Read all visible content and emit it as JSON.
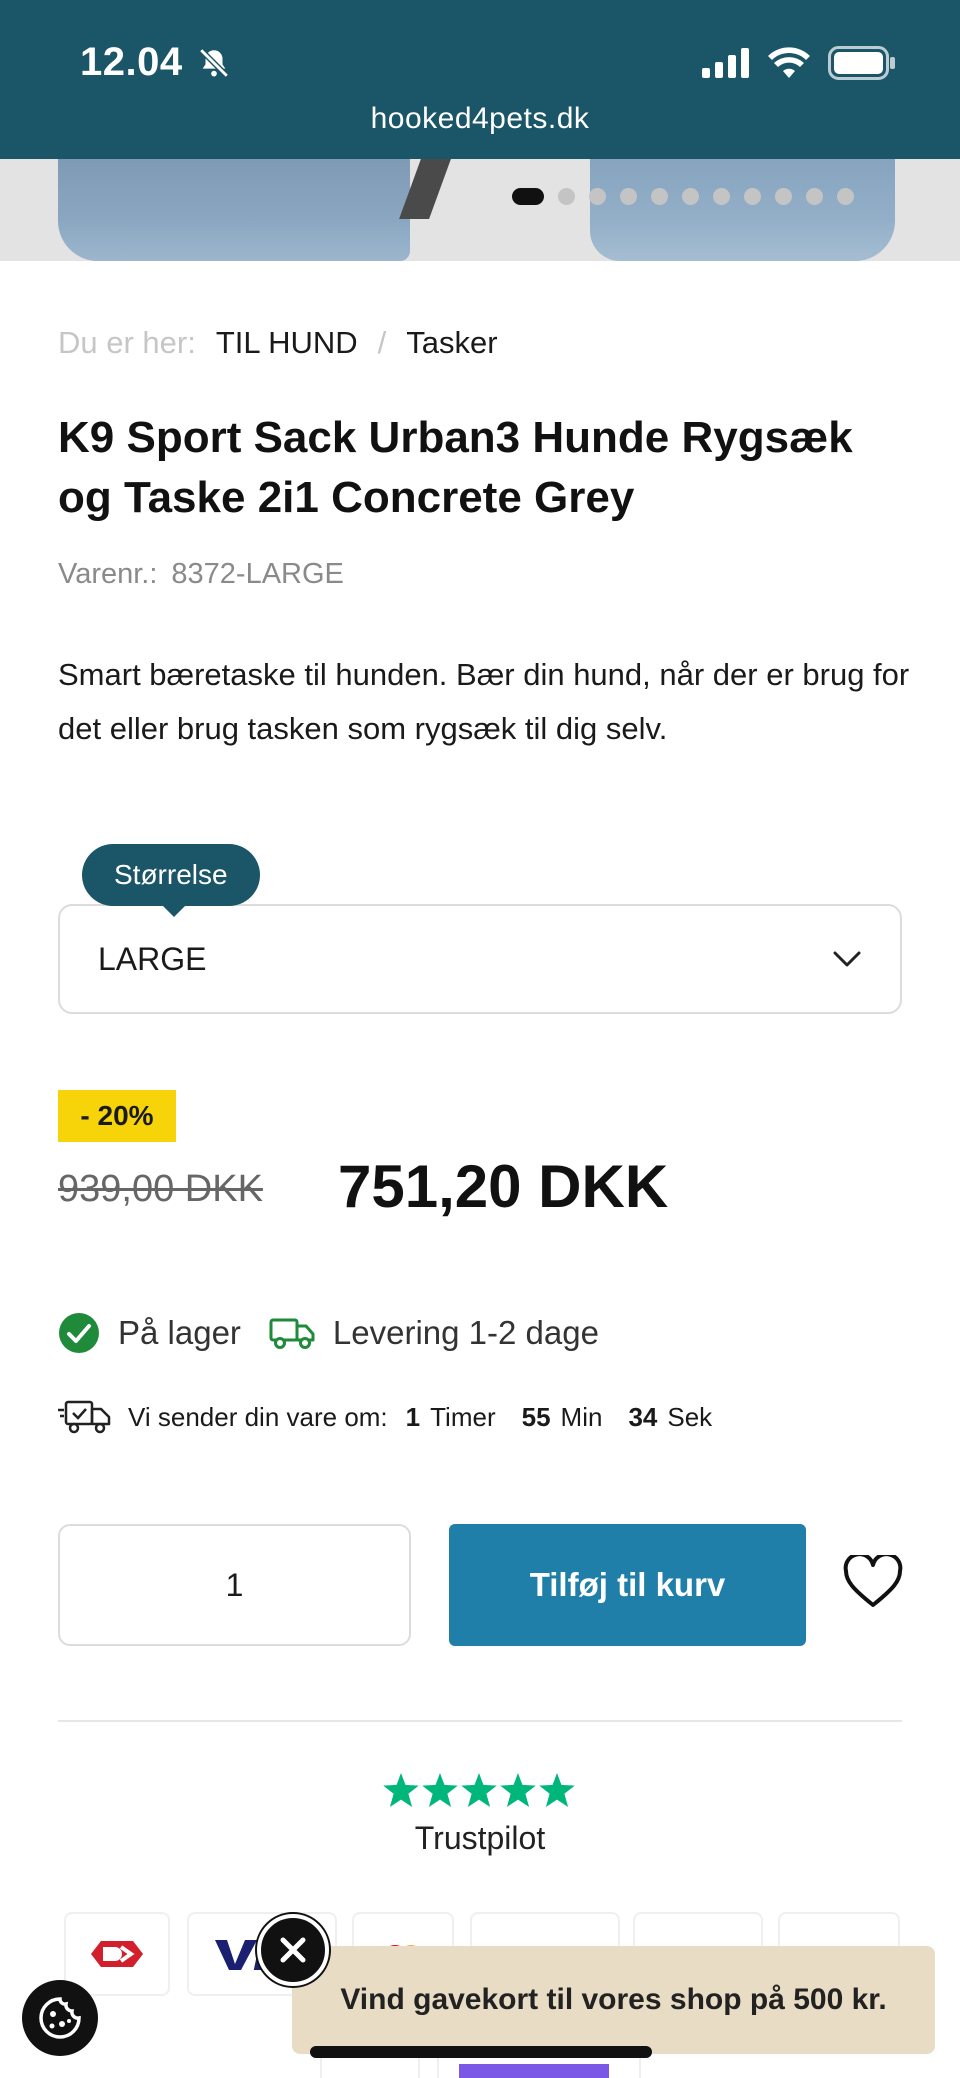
{
  "status_bar": {
    "time": "12.04"
  },
  "browser": {
    "url": "hooked4pets.dk"
  },
  "breadcrumb": {
    "prefix": "Du er her:",
    "items": [
      "TIL HUND",
      "Tasker"
    ],
    "separator": "/"
  },
  "product": {
    "title": "K9 Sport Sack Urban3 Hunde Rygsæk og Taske 2i1 Concrete Grey",
    "sku_label": "Varenr.:",
    "sku": "8372-LARGE",
    "description": "Smart bæretaske til hunden. Bær din hund, når der er brug for det eller brug tasken som rygsæk til dig selv."
  },
  "size": {
    "label": "Størrelse",
    "value": "LARGE"
  },
  "price": {
    "discount": "- 20%",
    "old": "939,00  DKK",
    "new": "751,20 DKK"
  },
  "stock": {
    "status": "På lager",
    "delivery": "Levering 1-2 dage"
  },
  "shipping_timer": {
    "label": "Vi sender din vare om:",
    "hours": "1",
    "hours_unit": "Timer",
    "minutes": "55",
    "minutes_unit": "Min",
    "seconds": "34",
    "seconds_unit": "Sek"
  },
  "cart": {
    "quantity": "1",
    "add_label": "Tilføj til kurv"
  },
  "trust": {
    "name": "Trustpilot",
    "rating_stars": 5,
    "star_color": "#00b67a"
  },
  "promo": {
    "text": "Vind gavekort til vores shop på 500 kr."
  },
  "colors": {
    "brand": "#1b5568",
    "button": "#1f7fa8",
    "discount": "#f7d40a",
    "in_stock": "#1e8a3a"
  }
}
